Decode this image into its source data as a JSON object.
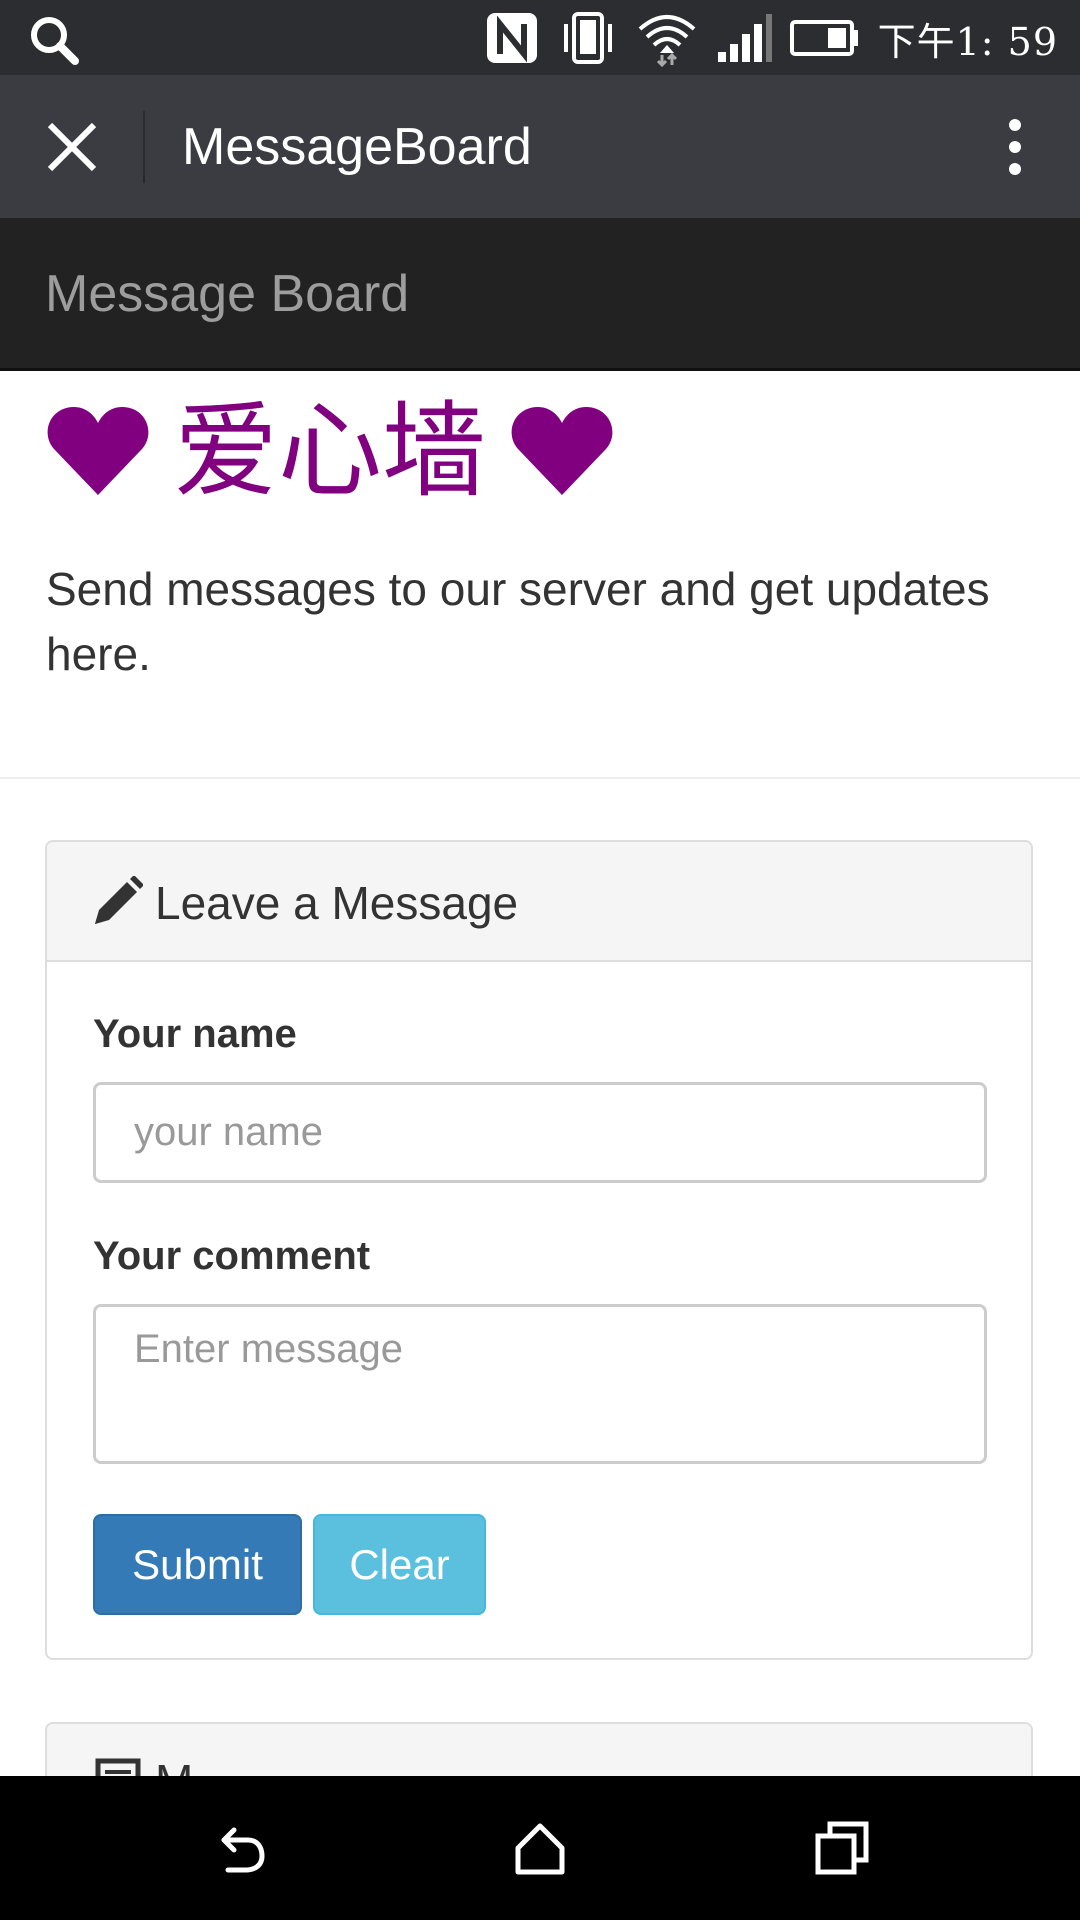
{
  "status_bar": {
    "time": "下午1: 59",
    "icons": [
      "search-icon",
      "nfc-icon",
      "vibrate-icon",
      "wifi-icon",
      "signal-icon",
      "battery-icon"
    ]
  },
  "app_bar": {
    "title": "MessageBoard",
    "icons": [
      "close-icon",
      "more-vert-icon"
    ]
  },
  "navbar": {
    "brand": "Message Board"
  },
  "hero": {
    "heading": "爱心墙",
    "heading_color": "#800080",
    "lead": "Send messages to our server and get updates here."
  },
  "form_panel": {
    "title": "Leave a Message",
    "icon": "pencil-icon",
    "name_label": "Your name",
    "name_placeholder": "your name",
    "name_value": "",
    "comment_label": "Your comment",
    "comment_placeholder": "Enter message",
    "comment_value": "",
    "submit_label": "Submit",
    "clear_label": "Clear",
    "submit_color": "#337ab7",
    "clear_color": "#5bc0de"
  },
  "messages_panel": {
    "title": "M",
    "icon": "list-icon"
  },
  "nav_bar": {
    "icons": [
      "back-icon",
      "home-icon",
      "recents-icon"
    ]
  }
}
